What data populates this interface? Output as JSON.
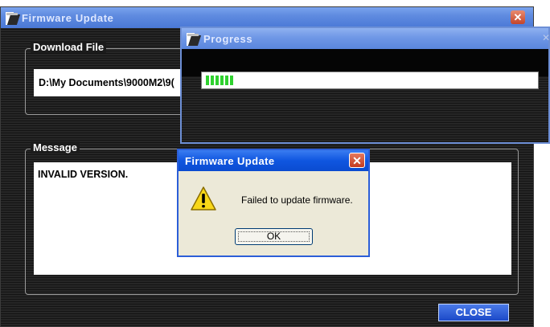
{
  "main_window": {
    "title": "Firmware Update",
    "download_label": "Download File",
    "download_path": "D:\\My Documents\\9000M2\\9(",
    "message_label": "Message",
    "message_text": "INVALID VERSION.",
    "close_button": "CLOSE"
  },
  "progress_window": {
    "title": "Progress",
    "progress_segments_filled": 6
  },
  "dialog": {
    "title": "Firmware Update",
    "message": "Failed to update firmware.",
    "ok_button": "OK"
  },
  "colors": {
    "window_background": "#1b1b1b",
    "progress_fill": "#2fd12f",
    "dialog_title": "#0f56e0",
    "close_button": "#1b49c8"
  },
  "icons": {
    "app": "app-logo-icon",
    "close": "close-icon",
    "warning": "warning-icon"
  }
}
